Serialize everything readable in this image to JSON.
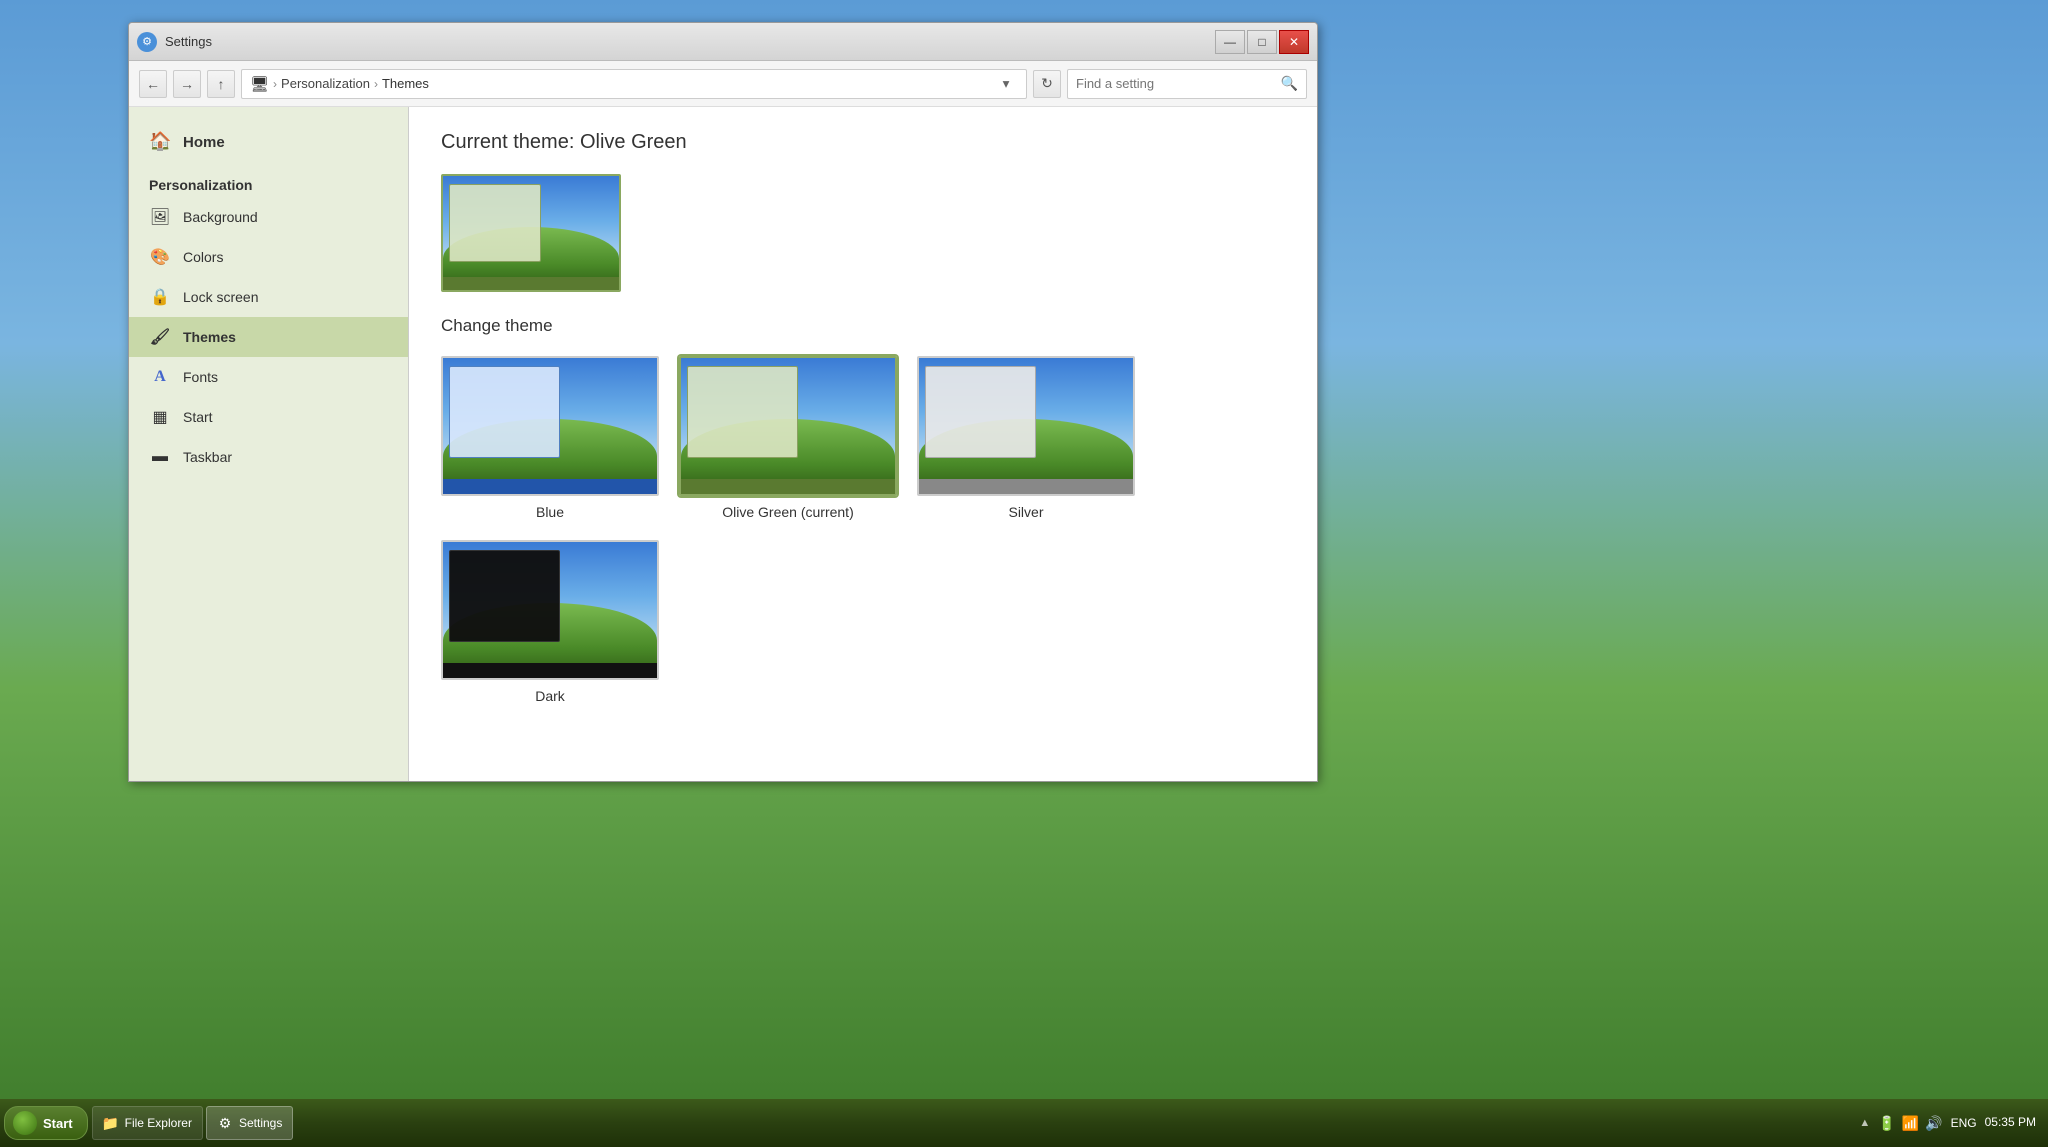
{
  "desktop": {
    "bg_desc": "Windows XP Bliss wallpaper style"
  },
  "window": {
    "title": "Settings",
    "title_icon": "⚙"
  },
  "titlebar": {
    "minimize_label": "—",
    "maximize_label": "□",
    "close_label": "✕"
  },
  "navbar": {
    "back_label": "←",
    "forward_label": "→",
    "up_label": "↑",
    "address_icon": "🖥",
    "breadcrumb": [
      {
        "label": "Personalization",
        "id": "personalization"
      },
      {
        "label": "Themes",
        "id": "themes"
      }
    ],
    "dropdown_label": "▾",
    "refresh_label": "↻",
    "search_placeholder": "Find a setting",
    "search_icon": "🔍"
  },
  "sidebar": {
    "home_label": "Home",
    "section_title": "Personalization",
    "items": [
      {
        "id": "background",
        "label": "Background",
        "icon": "🖼"
      },
      {
        "id": "colors",
        "label": "Colors",
        "icon": "🎨"
      },
      {
        "id": "lock-screen",
        "label": "Lock screen",
        "icon": "⚙"
      },
      {
        "id": "themes",
        "label": "Themes",
        "icon": "🖌",
        "active": true
      },
      {
        "id": "fonts",
        "label": "Fonts",
        "icon": "A"
      },
      {
        "id": "start",
        "label": "Start",
        "icon": "▦"
      },
      {
        "id": "taskbar",
        "label": "Taskbar",
        "icon": "▦"
      }
    ]
  },
  "content": {
    "current_theme_title": "Current theme: Olive Green",
    "change_theme_title": "Change theme",
    "themes": [
      {
        "id": "blue",
        "label": "Blue",
        "style": "blue",
        "selected": false
      },
      {
        "id": "olive-green",
        "label": "Olive Green (current)",
        "style": "olive",
        "selected": true
      },
      {
        "id": "silver",
        "label": "Silver",
        "style": "silver",
        "selected": false
      },
      {
        "id": "dark",
        "label": "Dark",
        "style": "dark",
        "selected": false
      }
    ]
  },
  "taskbar": {
    "start_label": "Start",
    "items": [
      {
        "id": "file-explorer",
        "label": "File Explorer",
        "icon": "📁"
      },
      {
        "id": "settings",
        "label": "Settings",
        "icon": "⚙",
        "active": true
      }
    ],
    "tray": {
      "lang": "ENG",
      "time": "05:35 PM",
      "date": ""
    }
  }
}
